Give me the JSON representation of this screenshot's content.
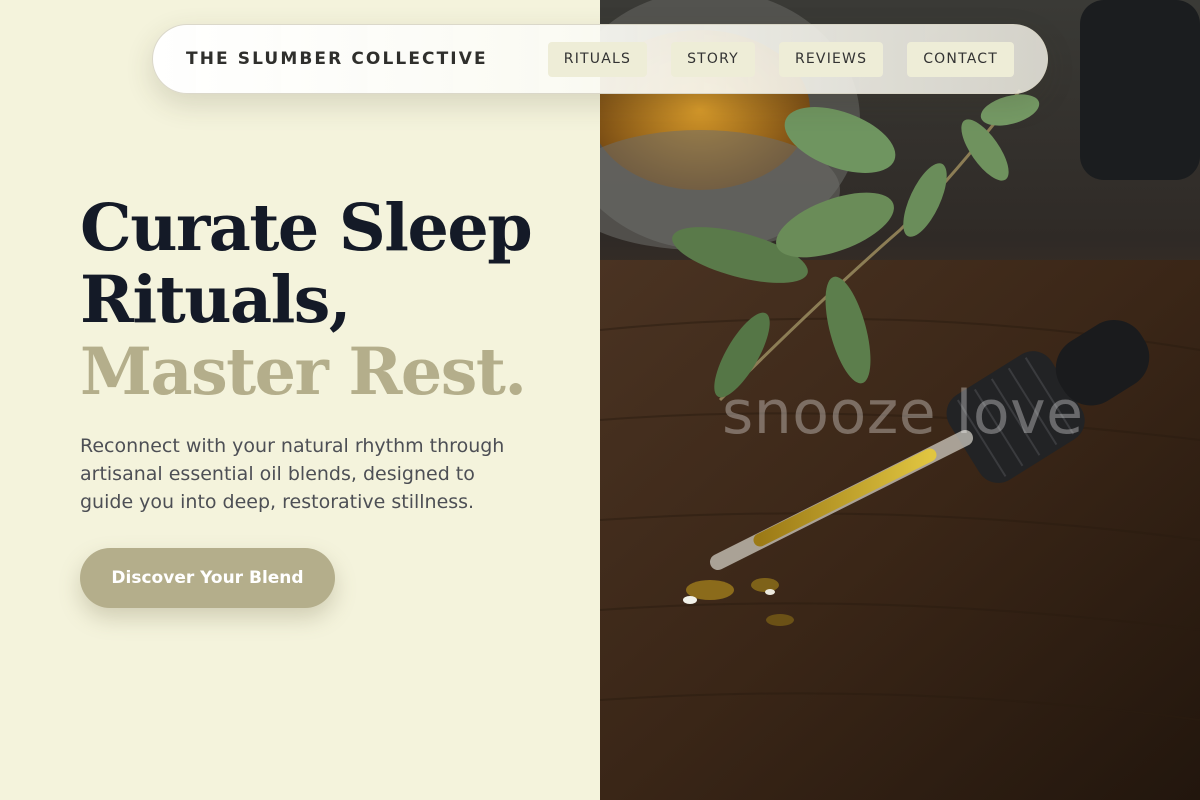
{
  "header": {
    "brand": "THE SLUMBER COLLECTIVE",
    "nav": [
      {
        "label": "RITUALS"
      },
      {
        "label": "STORY"
      },
      {
        "label": "REVIEWS"
      },
      {
        "label": "CONTACT"
      }
    ]
  },
  "hero": {
    "headline_line1": "Curate Sleep",
    "headline_line2": "Rituals,",
    "headline_line3": "Master Rest.",
    "description": "Reconnect with your natural rhythm through artisanal essential oil blends, designed to guide you into deep, restorative stillness.",
    "cta_label": "Discover Your Blend"
  },
  "image": {
    "watermark_text": "snooze love",
    "subject": "essential oil dropper with eucalyptus leaves on wooden table"
  },
  "colors": {
    "background": "#f4f3dc",
    "accent": "#b4ae8b",
    "heading": "#141a27",
    "body_text": "#4d4f55"
  }
}
